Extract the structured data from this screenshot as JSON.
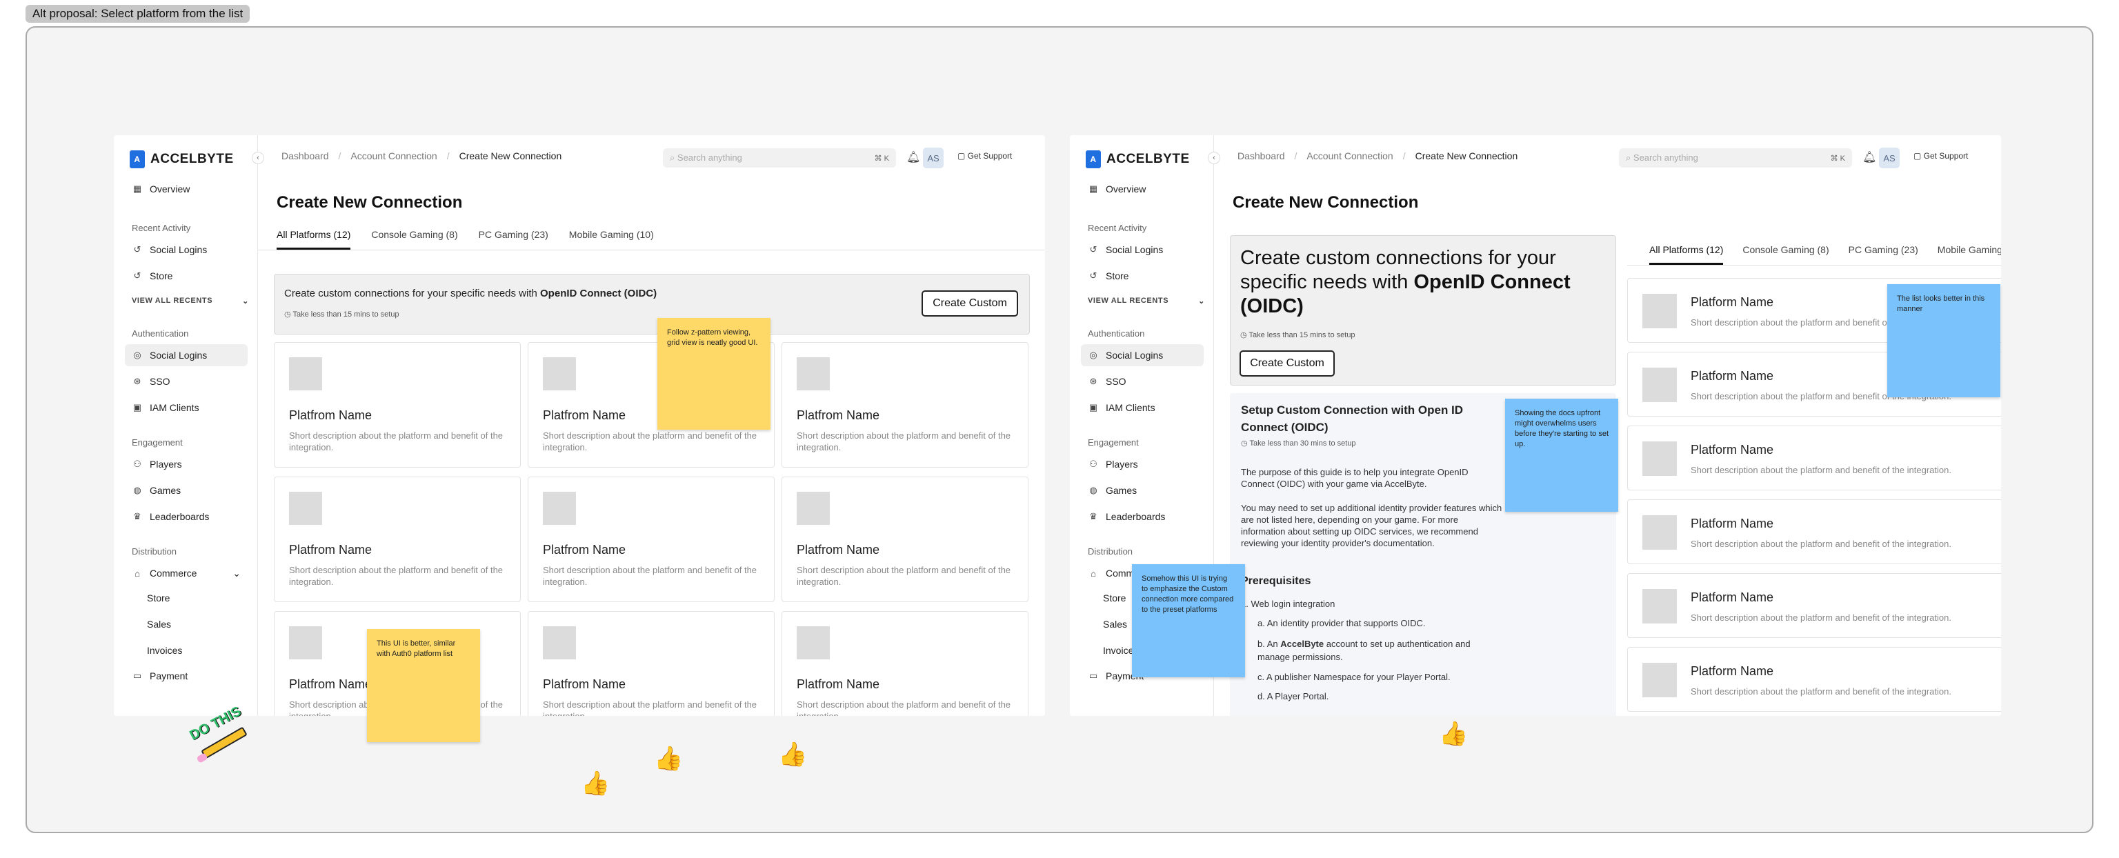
{
  "section_label": "Alt proposal: Select platform from the list",
  "app": {
    "brand": "ACCELBYTE",
    "logo_icon": "accelbyte-logo-icon",
    "sidebar": {
      "overview": "Overview",
      "recent_heading": "Recent Activity",
      "recent_items": [
        "Social Logins",
        "Store"
      ],
      "view_all": "VIEW ALL RECENTS",
      "auth_heading": "Authentication",
      "auth_items": [
        "Social Logins",
        "SSO",
        "IAM Clients"
      ],
      "engagement_heading": "Engagement",
      "engagement_items": [
        "Players",
        "Games",
        "Leaderboards"
      ],
      "distribution_heading": "Distribution",
      "commerce": "Commerce",
      "commerce_items": [
        "Store",
        "Sales",
        "Invoices"
      ],
      "payment": "Payment"
    },
    "breadcrumbs": [
      "Dashboard",
      "Account Connection",
      "Create New Connection"
    ],
    "search_placeholder": "Search anything",
    "search_shortcut": "⌘ K",
    "avatar_initials": "AS",
    "support": "Get Support",
    "page_title": "Create New Connection",
    "tabs": [
      "All Platforms (12)",
      "Console Gaming (8)",
      "PC Gaming (23)",
      "Mobile Gaming (10)"
    ]
  },
  "frame_a": {
    "banner_text": "Create custom connections for your specific needs with ",
    "banner_bold": "OpenID Connect (OIDC)",
    "banner_sub": "Take less than 15 mins to setup",
    "create_custom": "Create Custom",
    "card_name": "Platfrom Name",
    "card_desc": "Short description about the platform and benefit of the integration."
  },
  "frame_b": {
    "banner_text": "Create custom connections for your specific needs with ",
    "banner_bold": "OpenID Connect (OIDC)",
    "banner_sub": "Take less than 15 mins to setup",
    "create_custom": "Create Custom",
    "docs_title": "Setup Custom Connection with Open ID Connect (OIDC)",
    "docs_sub": "Take less than 30 mins to setup",
    "docs_p1": "The purpose of this guide is to help you integrate OpenID Connect (OIDC) with your game via AccelByte.",
    "docs_p2": "You may need to set up additional identity provider features which are not listed here, depending on your game. For more information about setting up OIDC services, we recommend reviewing your identity provider's documentation.",
    "prereq_heading": "Prerequisites",
    "prereq_1": "1. Web login integration",
    "prereq_a": "a.  An identity provider that supports OIDC.",
    "prereq_b_pre": "b.  An ",
    "prereq_b_bold": "AccelByte",
    "prereq_b_post": " account to set up authentication and manage permissions.",
    "prereq_c": "c.  A publisher Namespace for your Player Portal.",
    "prereq_d": "d.  A Player Portal.",
    "row_name": "Platform Name",
    "row_desc": "Short description about the platform and benefit of the integration."
  },
  "stickies": {
    "grid_view": "Follow z-pattern viewing, grid view is neatly good UI.",
    "auth0": "This UI is better, similar with Auth0 platform list",
    "docs_upfront": "Showing the docs upfront might overwhelms users before they're starting to set up.",
    "custom_emphasis": "Somehow this UI is trying to emphasize the Custom connection more compared to the preset platforms",
    "list_better": "The list looks better in this manner"
  },
  "stamp": "DO THIS",
  "reactions": [
    "👍",
    "👍",
    "👍",
    "👍"
  ]
}
